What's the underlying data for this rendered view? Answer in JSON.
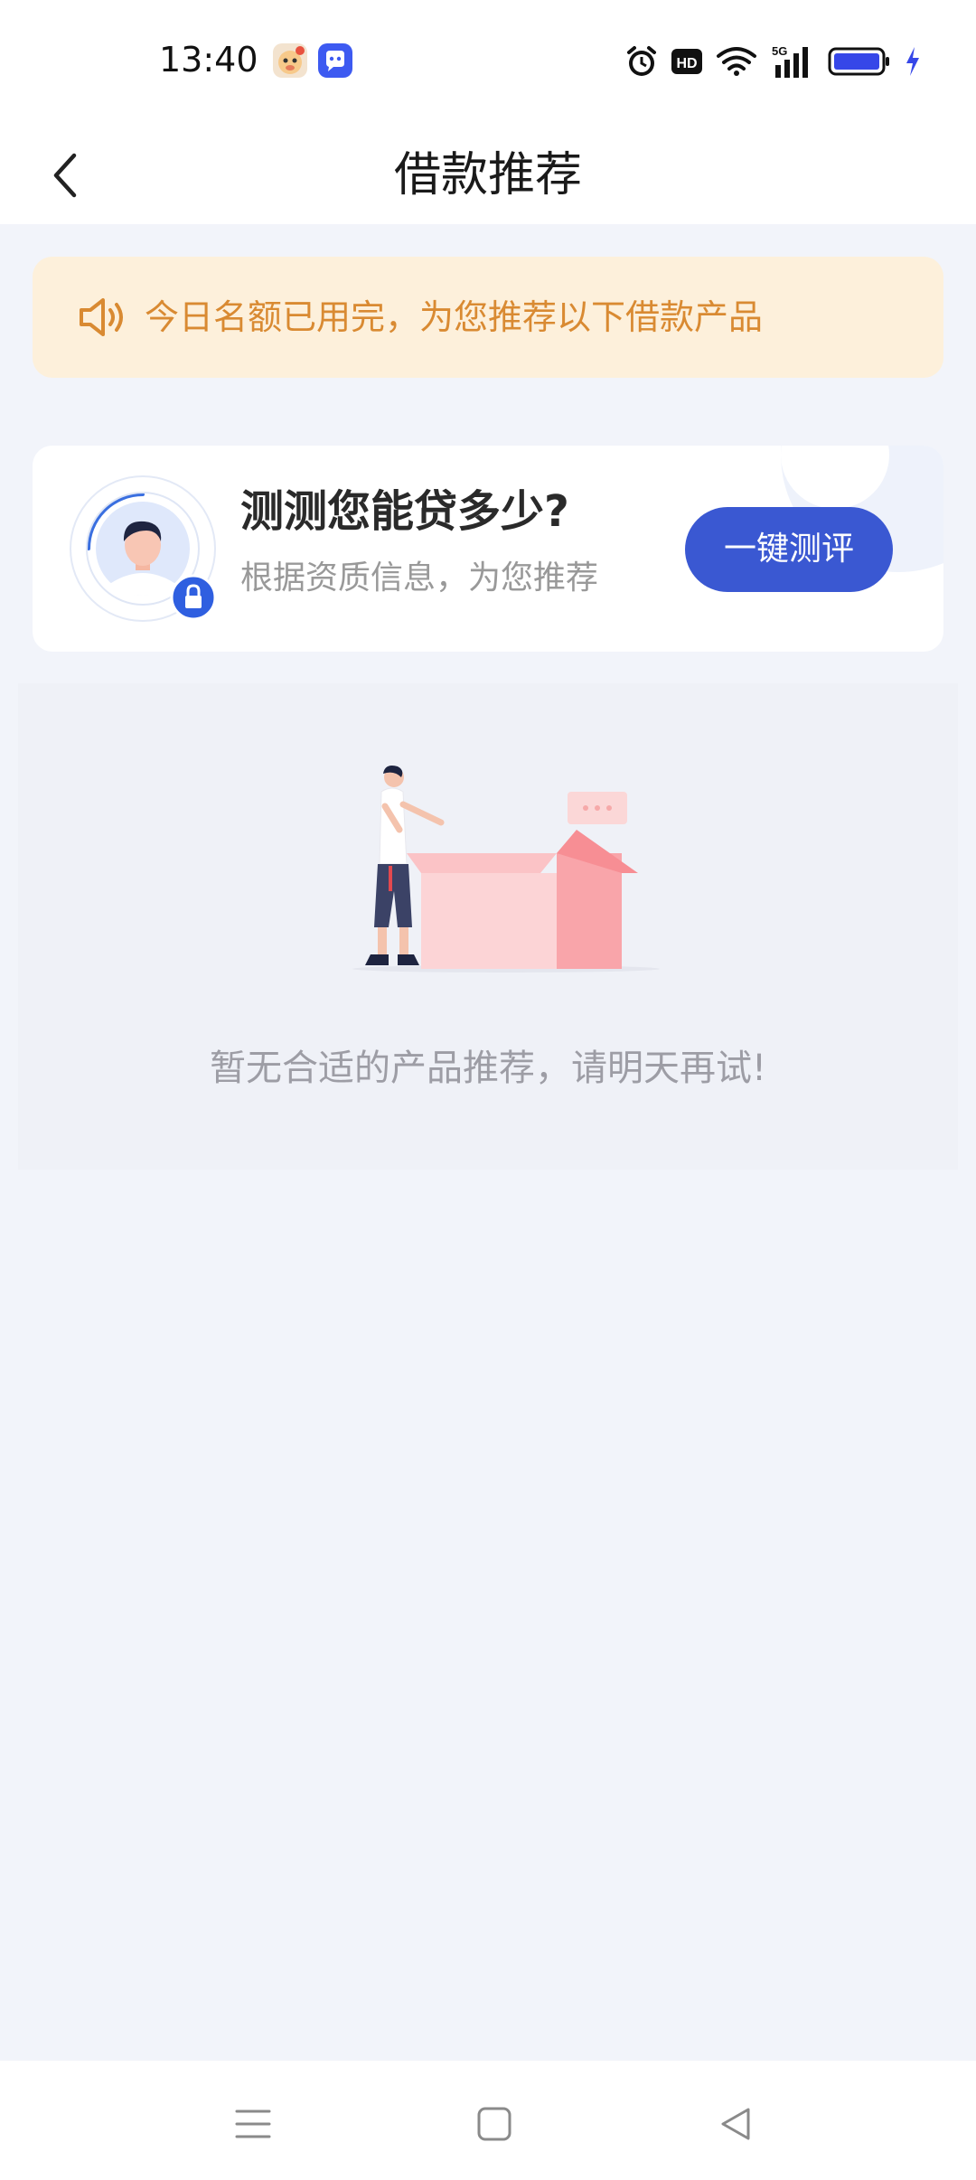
{
  "status_bar": {
    "time": "13:40",
    "apps": [
      "cartoon-app-icon",
      "chat-app-icon"
    ],
    "indicators": [
      "alarm-icon",
      "hd-icon",
      "wifi-icon",
      "5g-signal-icon",
      "battery-icon",
      "charging-icon"
    ],
    "network_label": "5G",
    "hd_label": "HD"
  },
  "header": {
    "title": "借款推荐",
    "back_icon": "chevron-left-icon"
  },
  "notice": {
    "icon": "speaker-icon",
    "text": "今日名额已用完，为您推荐以下借款产品",
    "color": "#d98a32",
    "background": "#fdf0db"
  },
  "eval_card": {
    "title": "测测您能贷多少?",
    "subtitle": "根据资质信息，为您推荐",
    "button_label": "一键测评",
    "button_color": "#3a58d2",
    "avatar_icon": "user-avatar-icon",
    "badge_icon": "lock-icon"
  },
  "empty_state": {
    "illustration": "person-with-box-illustration",
    "message": "暂无合适的产品推荐，请明天再试!"
  },
  "system_nav": {
    "menu_icon": "menu-icon",
    "home_icon": "home-square-icon",
    "back_icon": "back-triangle-icon"
  }
}
